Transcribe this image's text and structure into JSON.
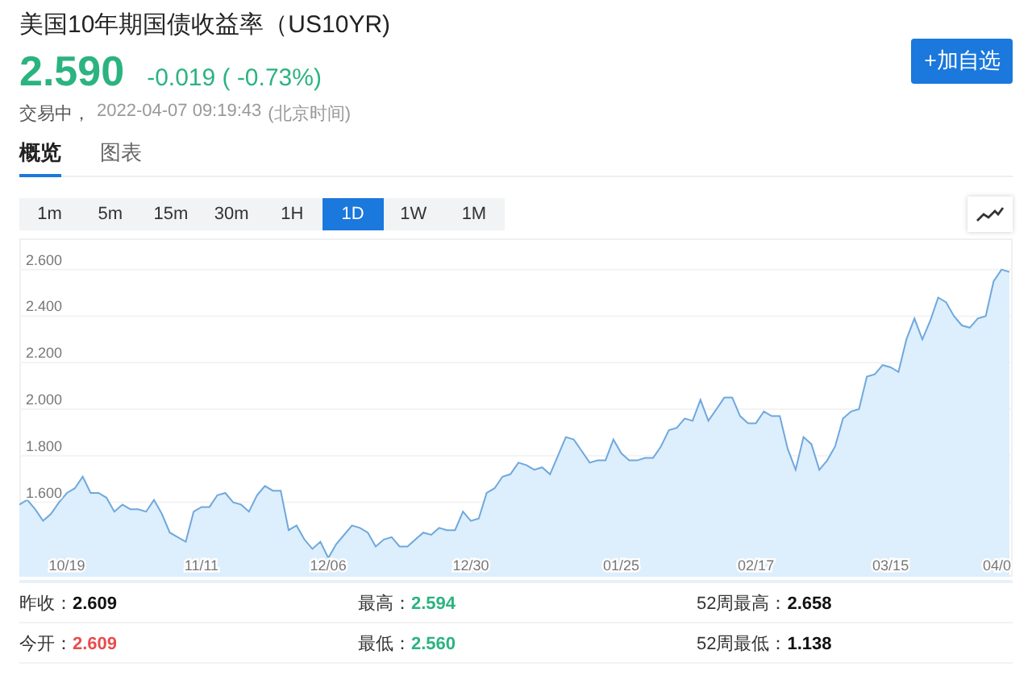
{
  "quote": {
    "title": "美国10年期国债收益率（US10YR)",
    "price": "2.590",
    "change": "-0.019 ( -0.73%)",
    "status": "交易中，",
    "timestamp": "2022-04-07 09:19:43",
    "timezone": "(北京时间)",
    "button": "+加自选"
  },
  "tabs": [
    {
      "label": "概览",
      "selected": true
    },
    {
      "label": "图表",
      "selected": false
    }
  ],
  "ranges": [
    {
      "label": "1m",
      "selected": false
    },
    {
      "label": "5m",
      "selected": false
    },
    {
      "label": "15m",
      "selected": false
    },
    {
      "label": "30m",
      "selected": false
    },
    {
      "label": "1H",
      "selected": false
    },
    {
      "label": "1D",
      "selected": true
    },
    {
      "label": "1W",
      "selected": false
    },
    {
      "label": "1M",
      "selected": false
    }
  ],
  "chart": {
    "chart_data": {
      "type": "area",
      "grid": true,
      "ylim": [
        1.28,
        2.72
      ],
      "yticks": [
        {
          "value": 1.6,
          "label": "1.600"
        },
        {
          "value": 1.8,
          "label": "1.800"
        },
        {
          "value": 2.0,
          "label": "2.000"
        },
        {
          "value": 2.2,
          "label": "2.200"
        },
        {
          "value": 2.4,
          "label": "2.400"
        },
        {
          "value": 2.6,
          "label": "2.600"
        }
      ],
      "categories": [
        null,
        null,
        null,
        null,
        null,
        null,
        "10/19",
        null,
        null,
        null,
        null,
        null,
        null,
        null,
        null,
        null,
        null,
        null,
        null,
        null,
        null,
        null,
        null,
        "11/11",
        null,
        null,
        null,
        null,
        null,
        null,
        null,
        null,
        null,
        null,
        null,
        null,
        null,
        null,
        null,
        "12/06",
        null,
        null,
        null,
        null,
        null,
        null,
        null,
        null,
        null,
        null,
        null,
        null,
        null,
        null,
        null,
        null,
        null,
        "12/30",
        null,
        null,
        null,
        null,
        null,
        null,
        null,
        null,
        null,
        null,
        null,
        null,
        null,
        null,
        null,
        null,
        null,
        null,
        "01/25",
        null,
        null,
        null,
        null,
        null,
        null,
        null,
        null,
        null,
        null,
        null,
        null,
        null,
        null,
        null,
        null,
        "02/17",
        null,
        null,
        null,
        null,
        null,
        null,
        null,
        null,
        null,
        null,
        null,
        null,
        null,
        null,
        null,
        null,
        "03/15",
        null,
        null,
        null,
        null,
        null,
        null,
        null,
        null,
        null,
        null,
        null,
        null,
        null,
        "04/0",
        null
      ],
      "series": [
        {
          "color": "#6fa8dc",
          "values": [
            1.59,
            1.61,
            1.57,
            1.52,
            1.55,
            1.6,
            1.64,
            1.66,
            1.71,
            1.64,
            1.64,
            1.62,
            1.56,
            1.59,
            1.57,
            1.57,
            1.56,
            1.61,
            1.55,
            1.47,
            1.45,
            1.43,
            1.56,
            1.58,
            1.58,
            1.63,
            1.64,
            1.6,
            1.59,
            1.56,
            1.63,
            1.67,
            1.65,
            1.65,
            1.48,
            1.5,
            1.44,
            1.4,
            1.43,
            1.36,
            1.42,
            1.46,
            1.5,
            1.49,
            1.47,
            1.41,
            1.44,
            1.45,
            1.41,
            1.41,
            1.44,
            1.47,
            1.46,
            1.49,
            1.48,
            1.48,
            1.56,
            1.52,
            1.53,
            1.64,
            1.66,
            1.71,
            1.72,
            1.77,
            1.76,
            1.74,
            1.75,
            1.72,
            1.8,
            1.88,
            1.87,
            1.82,
            1.77,
            1.78,
            1.78,
            1.87,
            1.81,
            1.78,
            1.78,
            1.79,
            1.79,
            1.84,
            1.91,
            1.92,
            1.96,
            1.95,
            2.04,
            1.95,
            2.0,
            2.05,
            2.05,
            1.97,
            1.94,
            1.94,
            1.99,
            1.97,
            1.97,
            1.83,
            1.74,
            1.88,
            1.85,
            1.74,
            1.78,
            1.84,
            1.96,
            1.99,
            2.0,
            2.14,
            2.15,
            2.19,
            2.18,
            2.16,
            2.3,
            2.39,
            2.3,
            2.38,
            2.48,
            2.46,
            2.4,
            2.36,
            2.35,
            2.39,
            2.4,
            2.55,
            2.6,
            2.59
          ]
        }
      ]
    }
  },
  "stats": [
    [
      {
        "label": "昨收：",
        "value": "2.609",
        "color": "#111111"
      },
      {
        "label": "最高：",
        "value": "2.594",
        "color": "#2bb380"
      },
      {
        "label": "52周最高：",
        "value": "2.658",
        "color": "#111111"
      }
    ],
    [
      {
        "label": "今开：",
        "value": "2.609",
        "color": "#e84c4c"
      },
      {
        "label": "最低：",
        "value": "2.560",
        "color": "#2bb380"
      },
      {
        "label": "52周最低：",
        "value": "1.138",
        "color": "#111111"
      }
    ]
  ]
}
